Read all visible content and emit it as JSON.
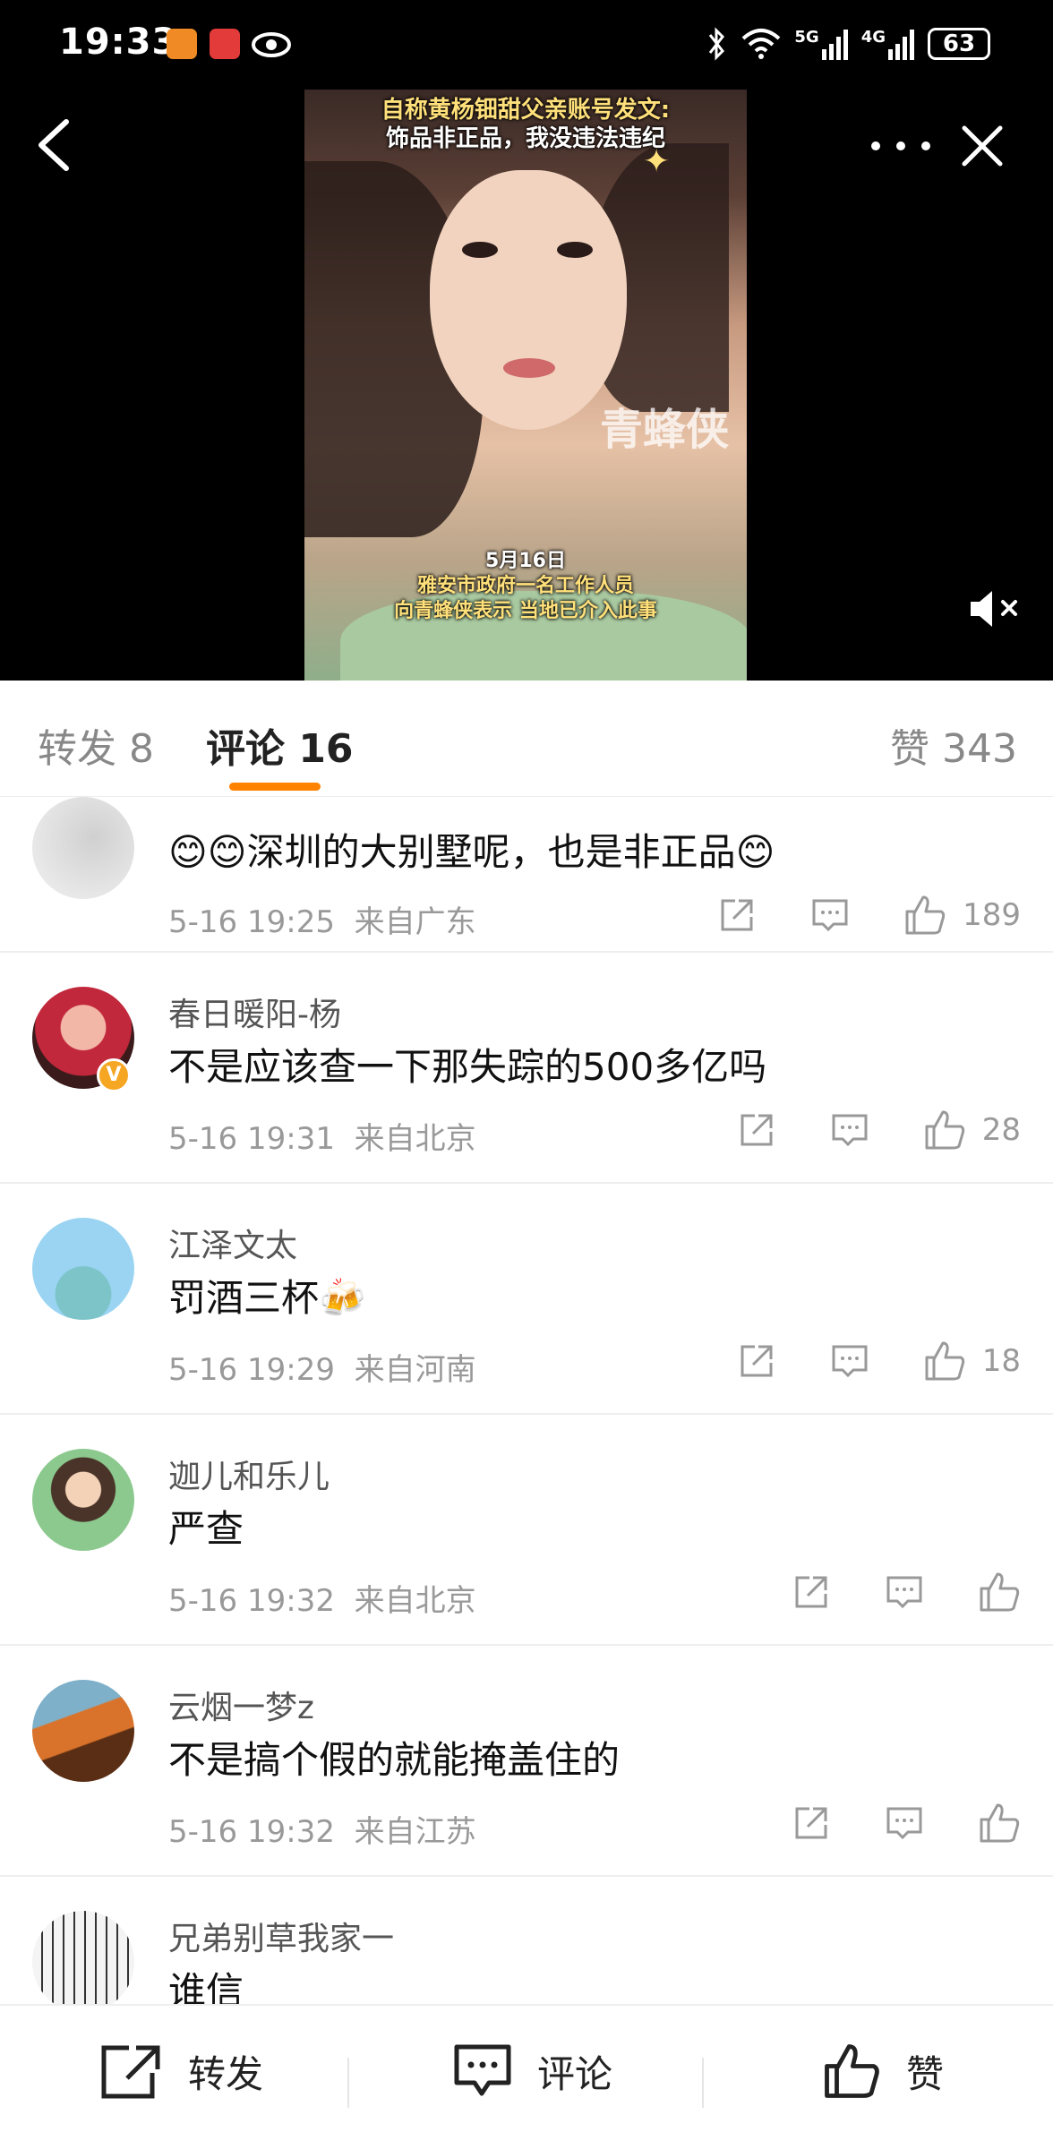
{
  "status_bar": {
    "time": "19:33",
    "network_5g": "5G",
    "network_4g": "4G",
    "battery": "63"
  },
  "video": {
    "headline_line1": "自称黄杨钿甜父亲账号发文:",
    "headline_line2": "饰品非正品，我没违法违纪",
    "watermark": "青蜂侠",
    "caption_line1": "5月16日",
    "caption_line2": "雅安市政府一名工作人员",
    "caption_line3": "向青蜂侠表示 当地已介入此事"
  },
  "tabs": {
    "repost": "转发 8",
    "comment": "评论 16",
    "likes": "赞 343"
  },
  "comments": [
    {
      "name": "",
      "text": "😊😊深圳的大别墅呢，也是非正品😊",
      "time": "5-16 19:25",
      "location": "来自广东",
      "likes": "189"
    },
    {
      "name": "春日暖阳-杨",
      "text": "不是应该查一下那失踪的500多亿吗",
      "time": "5-16 19:31",
      "location": "来自北京",
      "likes": "28",
      "verified": "V"
    },
    {
      "name": "江泽文太",
      "text": "罚酒三杯🍻",
      "time": "5-16 19:29",
      "location": "来自河南",
      "likes": "18"
    },
    {
      "name": "迦儿和乐儿",
      "text": "严查",
      "time": "5-16 19:32",
      "location": "来自北京",
      "likes": ""
    },
    {
      "name": "云烟一梦z",
      "text": "不是搞个假的就能掩盖住的",
      "time": "5-16 19:32",
      "location": "来自江苏",
      "likes": ""
    },
    {
      "name": "兄弟别草我家一",
      "text": "谁信",
      "time": "",
      "location": "",
      "likes": ""
    }
  ],
  "bottom_bar": {
    "repost": "转发",
    "comment": "评论",
    "like": "赞"
  }
}
